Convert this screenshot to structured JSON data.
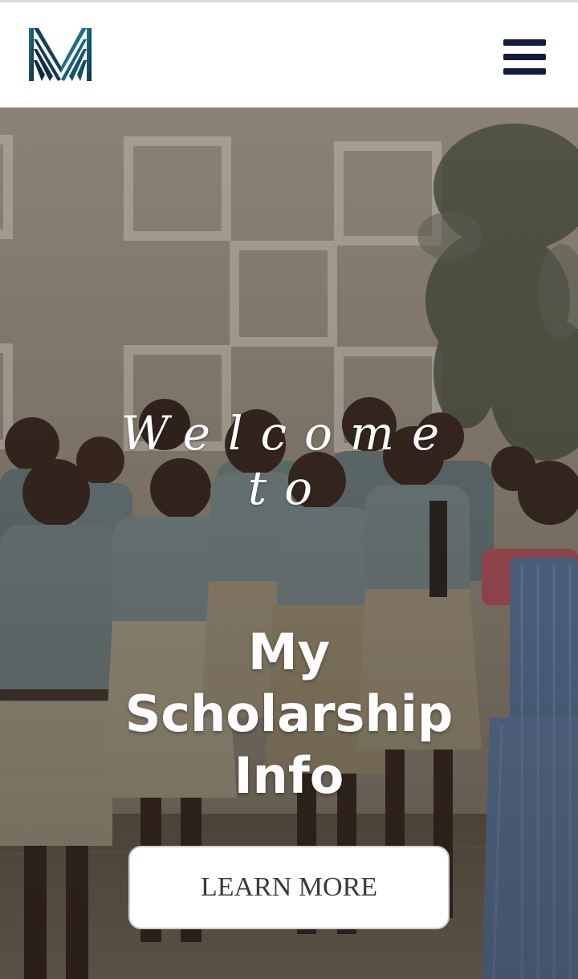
{
  "header": {
    "logo_icon": "m-logo-icon",
    "menu_icon": "hamburger-menu-icon"
  },
  "hero": {
    "welcome_lines": [
      "Welcome",
      "to"
    ],
    "title_lines": [
      "My",
      "Scholarship",
      "Info"
    ],
    "button_label": "LEARN MORE"
  },
  "colors": {
    "brand_navy": "#141a3f",
    "brand_teal": "#1c6d82",
    "button_bg": "#ffffff",
    "hero_text": "#ffffff"
  }
}
